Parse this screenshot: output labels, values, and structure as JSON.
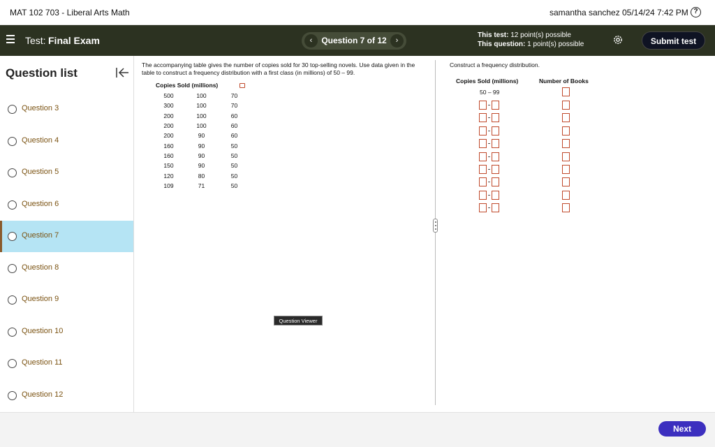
{
  "header": {
    "course": "MAT 102 703 - Liberal Arts Math",
    "user": "samantha sanchez",
    "datetime": "05/14/24 7:42 PM",
    "help_glyph": "?"
  },
  "testbar": {
    "prefix": "Test:",
    "name": "Final Exam",
    "question_nav": "Question 7 of 12",
    "prev_glyph": "‹",
    "next_glyph": "›",
    "this_test_label": "This test:",
    "this_test_value": "12 point(s) possible",
    "this_question_label": "This question:",
    "this_question_value": "1 point(s) possible",
    "submit_label": "Submit test"
  },
  "sidebar": {
    "title": "Question list",
    "items": [
      {
        "label": "Question 3"
      },
      {
        "label": "Question 4"
      },
      {
        "label": "Question 5"
      },
      {
        "label": "Question 6"
      },
      {
        "label": "Question 7",
        "active": true
      },
      {
        "label": "Question 8"
      },
      {
        "label": "Question 9"
      },
      {
        "label": "Question 10"
      },
      {
        "label": "Question 11"
      },
      {
        "label": "Question 12"
      }
    ]
  },
  "question": {
    "text": "The accompanying table gives the number of copies sold for 30 top-selling novels. Use data given in the table to construct a frequency distribution with a first class (in millions) of 50 – 99.",
    "table_header": "Copies Sold (millions)",
    "rows": [
      [
        "500",
        "100",
        "70"
      ],
      [
        "300",
        "100",
        "70"
      ],
      [
        "200",
        "100",
        "60"
      ],
      [
        "200",
        "100",
        "60"
      ],
      [
        "200",
        "90",
        "60"
      ],
      [
        "160",
        "90",
        "50"
      ],
      [
        "160",
        "90",
        "50"
      ],
      [
        "150",
        "90",
        "50"
      ],
      [
        "120",
        "80",
        "50"
      ],
      [
        "109",
        "71",
        "50"
      ]
    ]
  },
  "viewer_tag": "Question Viewer",
  "answer": {
    "instruction": "Construct a frequency distribution.",
    "col_copies": "Copies Sold (millions)",
    "col_number": "Number of Books",
    "first_class": "50 – 99",
    "blank_rows": 9
  },
  "footer": {
    "next_label": "Next"
  },
  "colors": {
    "testbar_bg": "#2c3221",
    "active_item_bg": "#b5e4f4",
    "input_border": "#c0492b",
    "next_button": "#3c2fbf",
    "question_link": "#7b5312"
  }
}
